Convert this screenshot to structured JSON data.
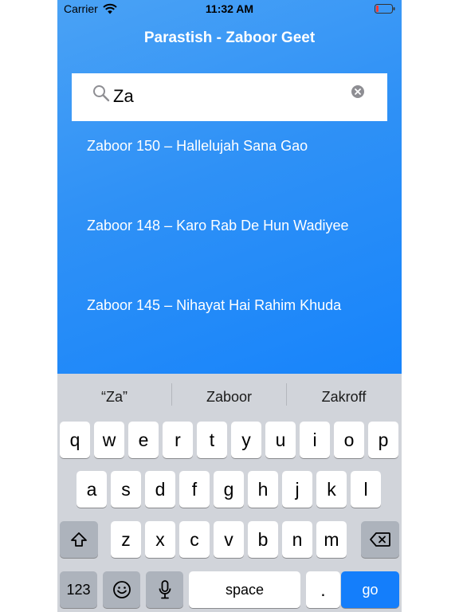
{
  "status": {
    "carrier": "Carrier",
    "time": "11:32 AM"
  },
  "header": {
    "title": "Parastish - Zaboor Geet"
  },
  "search": {
    "value": "Za"
  },
  "results": [
    {
      "label": "Zaboor 150 – Hallelujah Sana Gao"
    },
    {
      "label": "Zaboor 148 – Karo Rab De Hun Wadiyee"
    },
    {
      "label": "Zaboor 145 – Nihayat Hai Rahim Khuda"
    }
  ],
  "keyboard": {
    "suggestions": [
      "“Za”",
      "Zaboor",
      "Zakroff"
    ],
    "row1": [
      "q",
      "w",
      "e",
      "r",
      "t",
      "y",
      "u",
      "i",
      "o",
      "p"
    ],
    "row2": [
      "a",
      "s",
      "d",
      "f",
      "g",
      "h",
      "j",
      "k",
      "l"
    ],
    "row3": [
      "z",
      "x",
      "c",
      "v",
      "b",
      "n",
      "m"
    ],
    "numbers_label": "123",
    "space_label": "space",
    "period_label": ".",
    "go_label": "go"
  },
  "colors": {
    "accent": "#147efb",
    "gradient_start": "#4aa2f5",
    "gradient_end": "#1784fb",
    "battery_low": "#ff3b30"
  },
  "icons": [
    "wifi-icon",
    "battery-icon",
    "search-icon",
    "clear-icon",
    "shift-icon",
    "emoji-icon",
    "microphone-icon",
    "backspace-icon"
  ]
}
